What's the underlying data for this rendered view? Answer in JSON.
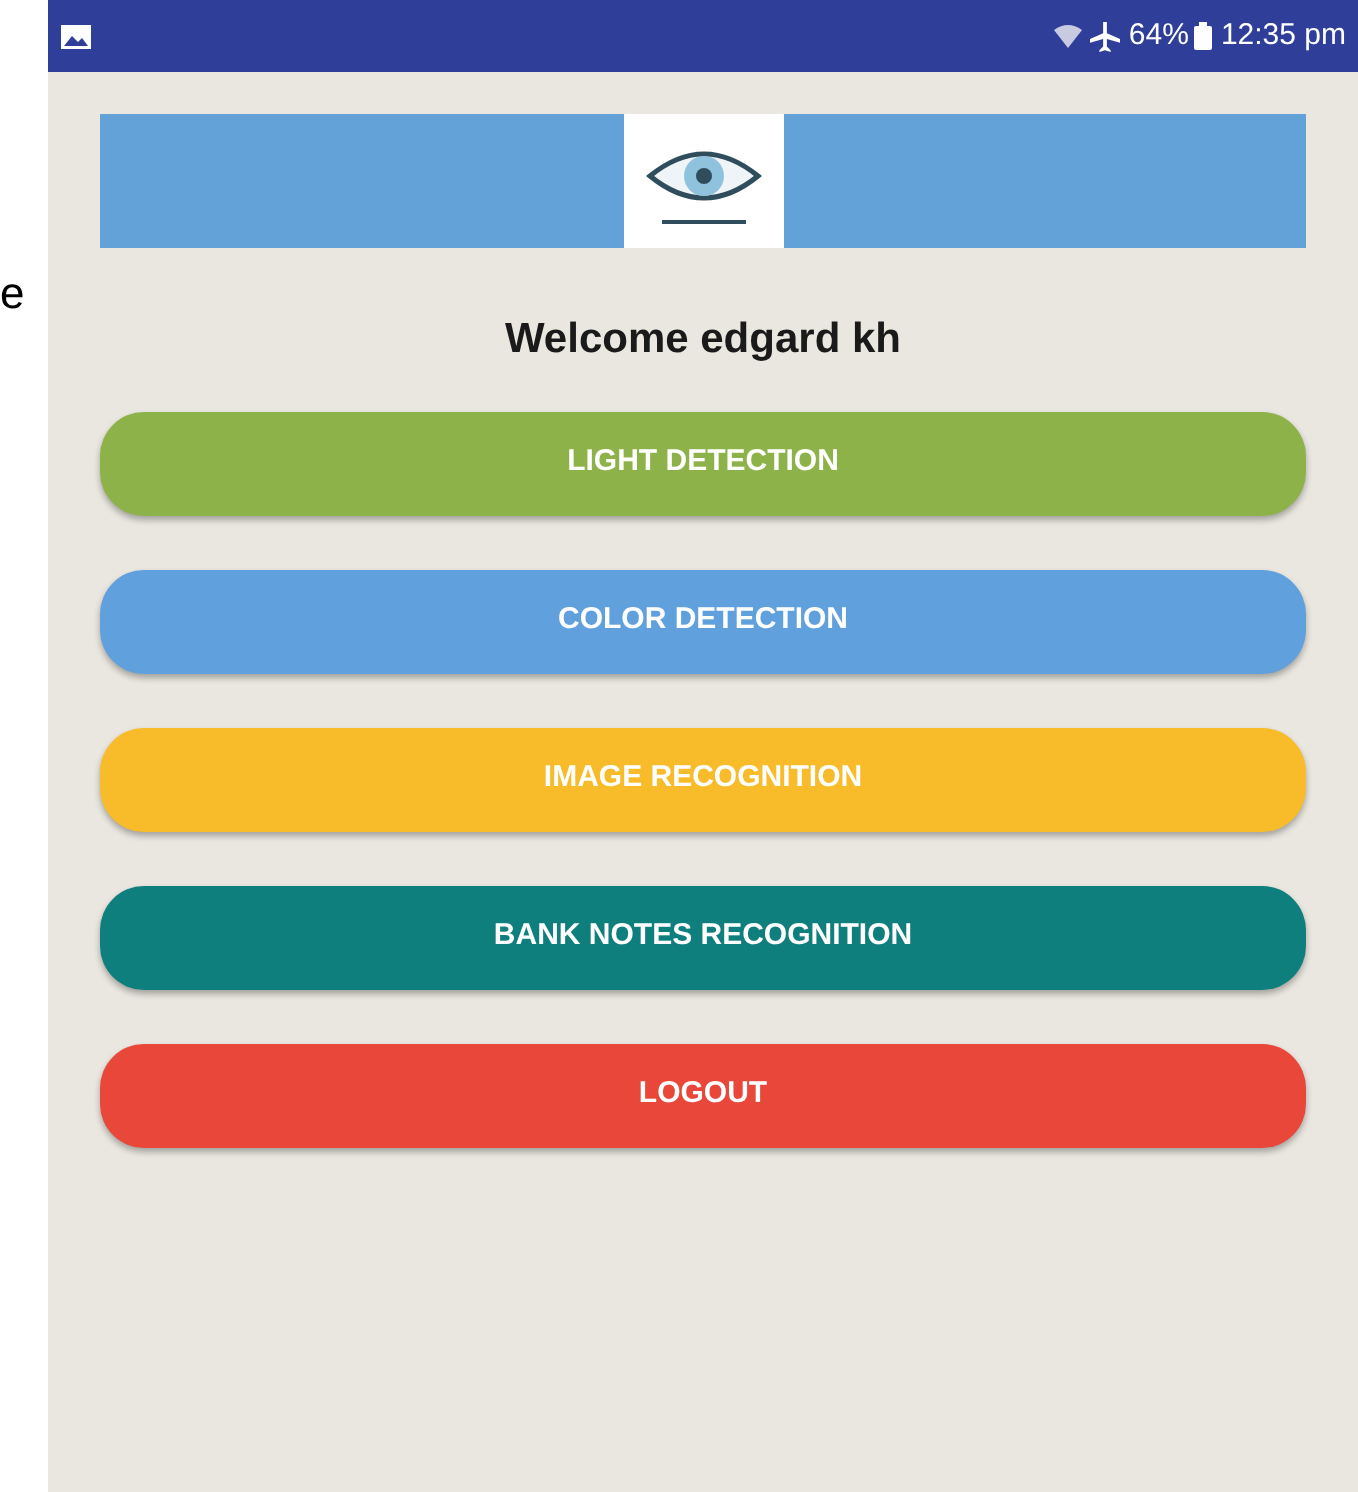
{
  "margin_text": "e",
  "status_bar": {
    "battery": "64%",
    "time": "12:35 pm"
  },
  "welcome": "Welcome edgard kh",
  "buttons": [
    {
      "label": "LIGHT DETECTION",
      "color": "#8db24a"
    },
    {
      "label": "COLOR DETECTION",
      "color": "#5fa0dd"
    },
    {
      "label": "IMAGE RECOGNITION",
      "color": "#f8bc2a"
    },
    {
      "label": "BANK NOTES RECOGNITION",
      "color": "#0f7f7d"
    },
    {
      "label": "LOGOUT",
      "color": "#e8473a"
    }
  ]
}
